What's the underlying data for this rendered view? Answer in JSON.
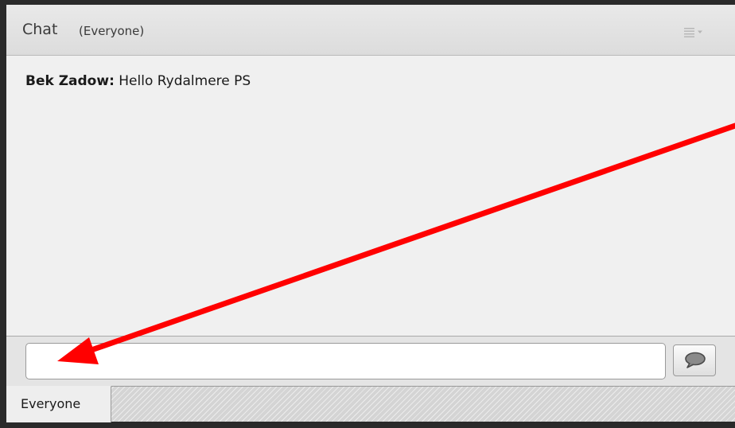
{
  "pod": {
    "title": "Chat",
    "subtitle": "(Everyone)",
    "menu_icon": "pod-options-menu-icon"
  },
  "messages": [
    {
      "sender": "Bek Zadow:",
      "text": " Hello Rydalmere PS"
    }
  ],
  "input": {
    "value": "",
    "placeholder": ""
  },
  "send_button": {
    "icon": "speech-bubble-icon"
  },
  "tabs": [
    {
      "label": "Everyone",
      "selected": true
    }
  ],
  "annotation": {
    "type": "arrow",
    "color": "#ff0000"
  }
}
